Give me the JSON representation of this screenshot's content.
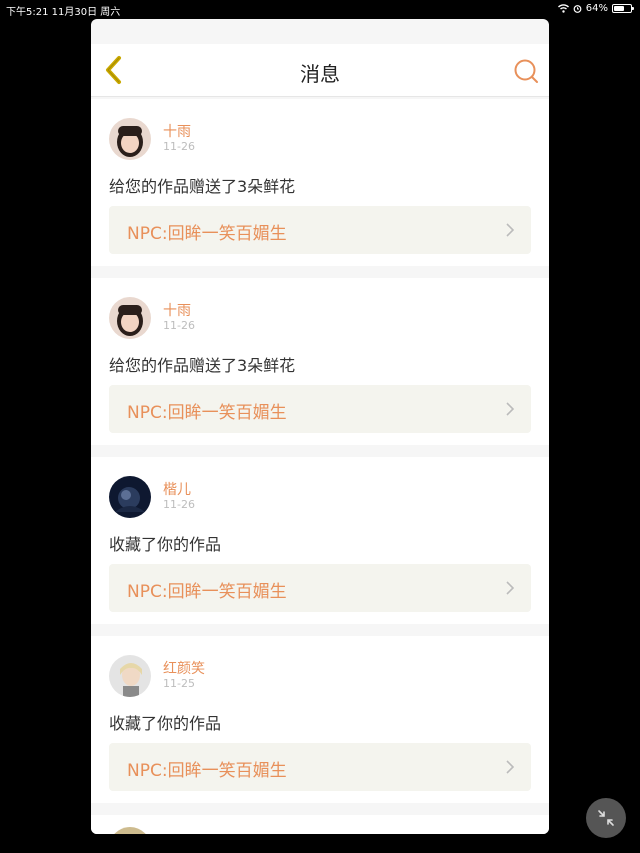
{
  "status_bar": {
    "left_text": "下午5:21  11月30日 周六",
    "battery": "64%",
    "battery_level": 0.64
  },
  "header": {
    "title": "消息"
  },
  "messages": [
    {
      "user": "十雨",
      "date": "11-26",
      "action": "给您的作品赠送了3朵鲜花",
      "work": "NPC:回眸一笑百媚生"
    },
    {
      "user": "十雨",
      "date": "11-26",
      "action": "给您的作品赠送了3朵鲜花",
      "work": "NPC:回眸一笑百媚生"
    },
    {
      "user": "楷儿",
      "date": "11-26",
      "action": "收藏了你的作品",
      "work": "NPC:回眸一笑百媚生"
    },
    {
      "user": "红颜笑",
      "date": "11-25",
      "action": "收藏了你的作品",
      "work": "NPC:回眸一笑百媚生"
    }
  ],
  "colors": {
    "accent": "#e8905a",
    "back_arrow": "#c9a800",
    "link_bg": "#f4f4ee"
  }
}
